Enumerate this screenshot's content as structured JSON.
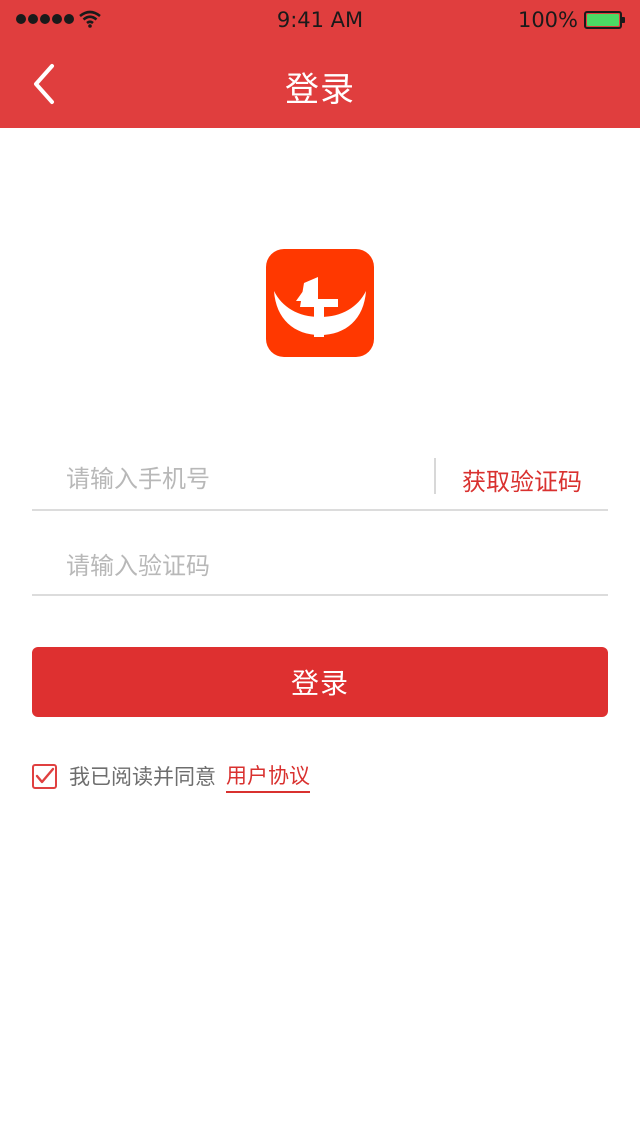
{
  "status_bar": {
    "time": "9:41 AM",
    "battery": "100%",
    "signal_icon": "signal-dots-icon",
    "wifi_icon": "wifi-icon",
    "battery_icon": "battery-icon"
  },
  "nav": {
    "title": "登录",
    "back_icon": "chevron-left-icon"
  },
  "logo": {
    "icon": "app-logo-icon",
    "color": "#ff3800"
  },
  "form": {
    "phone_placeholder": "请输入手机号",
    "phone_value": "",
    "get_code_label": "获取验证码",
    "code_placeholder": "请输入验证码",
    "code_value": ""
  },
  "login_button": {
    "label": "登录"
  },
  "agreement": {
    "checked": true,
    "text": "我已阅读并同意",
    "link": "用户协议"
  },
  "colors": {
    "brand": "#e03e3e",
    "accent": "#de3030",
    "link": "#d9312f"
  }
}
